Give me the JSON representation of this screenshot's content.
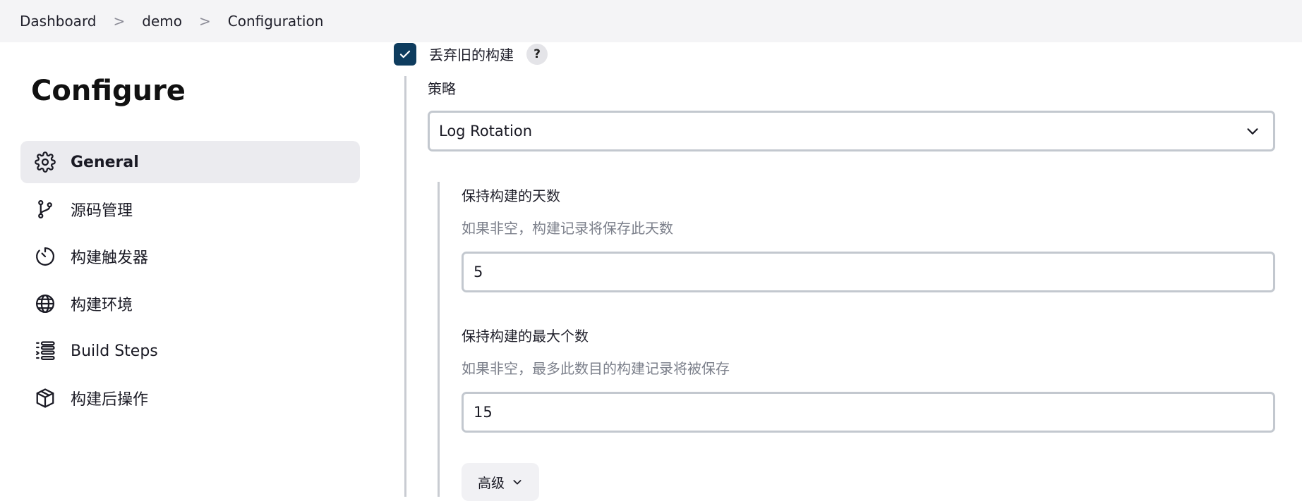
{
  "breadcrumb": {
    "items": [
      "Dashboard",
      "demo",
      "Configuration"
    ],
    "separator": ">"
  },
  "sidebar": {
    "title": "Configure",
    "items": [
      {
        "label": "General",
        "icon": "gear-icon",
        "active": true
      },
      {
        "label": "源码管理",
        "icon": "git-branch-icon",
        "active": false
      },
      {
        "label": "构建触发器",
        "icon": "timer-icon",
        "active": false
      },
      {
        "label": "构建环境",
        "icon": "globe-icon",
        "active": false
      },
      {
        "label": "Build Steps",
        "icon": "list-icon",
        "active": false
      },
      {
        "label": "构建后操作",
        "icon": "package-icon",
        "active": false
      }
    ]
  },
  "main": {
    "discard_old_builds": {
      "label": "丢弃旧的构建",
      "checked": true,
      "help": "?"
    },
    "strategy": {
      "label": "策略",
      "selected": "Log Rotation"
    },
    "days_to_keep": {
      "label": "保持构建的天数",
      "description": "如果非空，构建记录将保存此天数",
      "value": "5"
    },
    "max_builds": {
      "label": "保持构建的最大个数",
      "description": "如果非空，最多此数目的构建记录将被保存",
      "value": "15"
    },
    "advanced_button": {
      "label": "高级"
    }
  },
  "colors": {
    "checkbox_bg": "#0e3c5e",
    "active_nav_bg": "#ebebef",
    "topbar_bg": "#f4f4f6",
    "description_text": "#7b7f8a"
  }
}
